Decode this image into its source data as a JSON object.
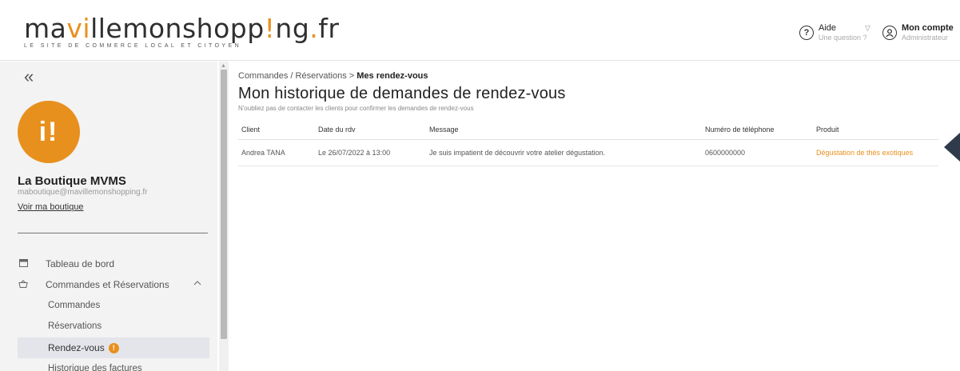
{
  "header": {
    "logo_prefix": "ma",
    "logo_ville_a": "vi",
    "logo_ville_b": "lle",
    "logo_mid": "monshopp",
    "logo_excl": "!",
    "logo_end": "ng",
    "logo_dot": ".",
    "logo_tld": "fr",
    "tagline": "LE SITE DE COMMERCE LOCAL ET CITOYEN",
    "help_icon": "?",
    "help_title": "Aide",
    "help_sub": "Une question ?",
    "caret": "▽",
    "account_title": "Mon compte",
    "account_sub": "Administrateur"
  },
  "sidebar": {
    "collapse_icon": "«",
    "avatar_text": "i!",
    "shop_name": "La Boutique MVMS",
    "shop_email": "maboutique@mavillemonshopping.fr",
    "shop_link": "Voir ma boutique",
    "nav": {
      "dashboard": "Tableau de bord",
      "orders_group": "Commandes et Réservations",
      "sub_orders": "Commandes",
      "sub_reservations": "Réservations",
      "sub_appointments": "Rendez-vous",
      "sub_appointments_badge": "!",
      "sub_invoices": "Historique des factures"
    }
  },
  "main": {
    "breadcrumb_path": "Commandes / Réservations > ",
    "breadcrumb_current": "Mes rendez-vous",
    "title": "Mon historique de demandes de rendez-vous",
    "subtitle": "N'oubliez pas de contacter les clients pour confirmer les demandes de rendez-vous",
    "columns": {
      "client": "Client",
      "date": "Date du rdv",
      "message": "Message",
      "phone": "Numéro de téléphone",
      "product": "Produit"
    },
    "rows": [
      {
        "client": "Andrea TANA",
        "date": "Le 26/07/2022 à 13:00",
        "message": "Je suis impatient de découvrir votre atelier dégustation.",
        "phone": "0600000000",
        "product": "Dégustation de thés exotiques"
      }
    ]
  },
  "colors": {
    "accent": "#e8901d",
    "sidebar_bg": "#f3f3f3",
    "active_item_bg": "#e3e5ea",
    "arrow": "#2f3b4b"
  }
}
